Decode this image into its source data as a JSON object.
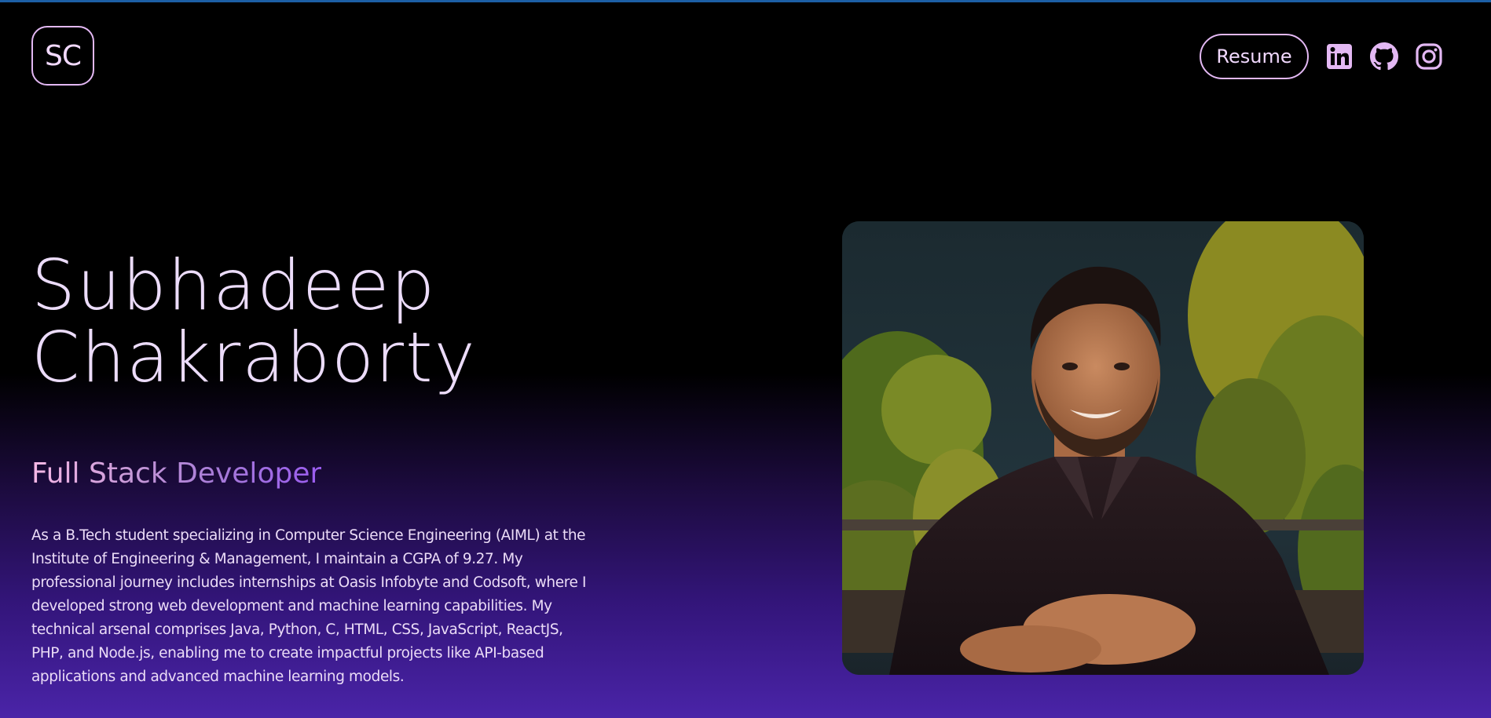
{
  "header": {
    "logo_text": "SC",
    "resume_label": "Resume",
    "social_icons": [
      "linkedin-icon",
      "github-icon",
      "instagram-icon"
    ]
  },
  "hero": {
    "first_name": "Subhadeep",
    "last_name": "Chakraborty",
    "role": "Full Stack Developer",
    "bio": "As a B.Tech student specializing in Computer Science Engineering (AIML) at the Institute of Engineering & Management, I maintain a CGPA of 9.27. My professional journey includes internships at Oasis Infobyte and Codsoft, where I developed strong web development and machine learning capabilities. My technical arsenal comprises Java, Python, C, HTML, CSS, JavaScript, ReactJS, PHP, and Node.js, enabling me to create impactful projects like API-based applications and advanced machine learning models."
  },
  "colors": {
    "accent": "#e3b8f3",
    "top_line": "#1c5fa5",
    "gradient_bottom": "#4a24a8"
  }
}
